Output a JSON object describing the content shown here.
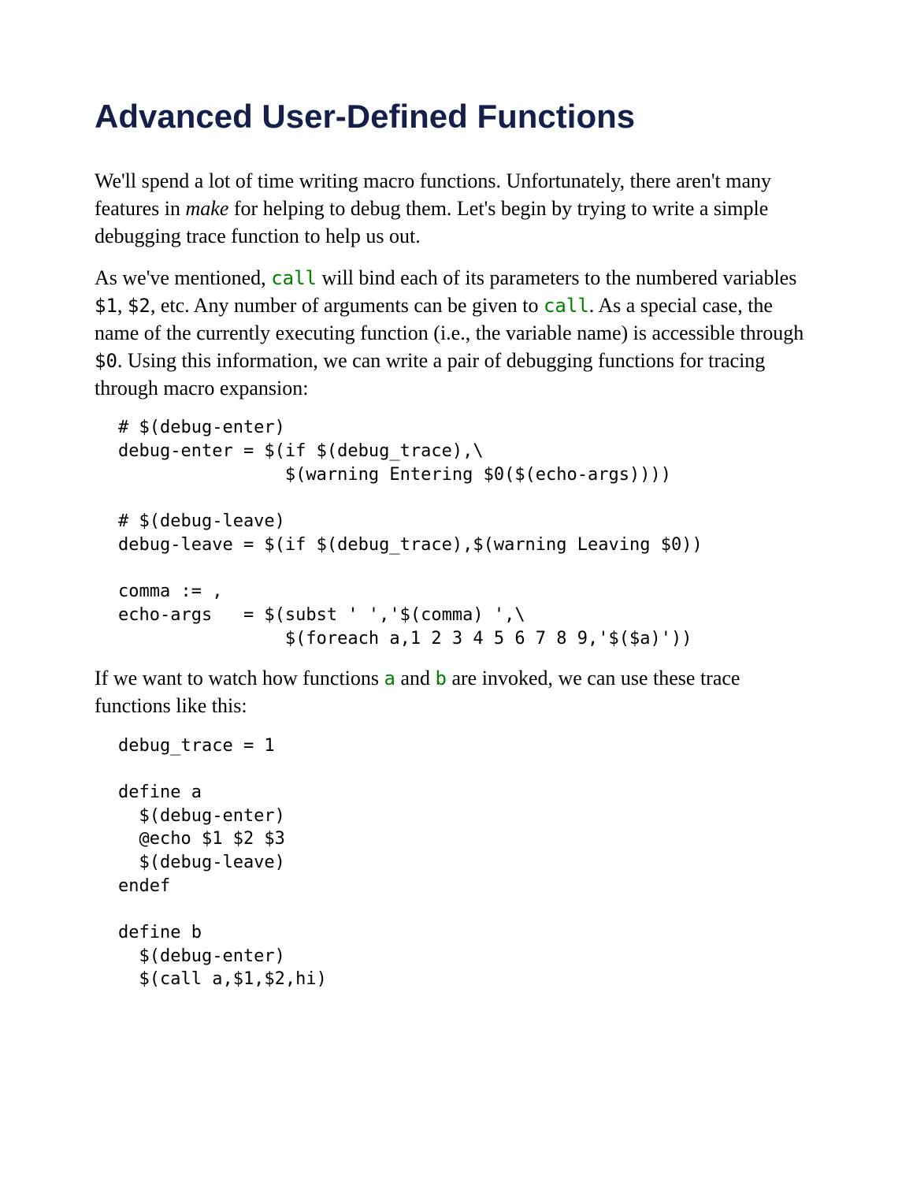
{
  "title": "Advanced User-Defined Functions",
  "para1_a": "We'll spend a lot of time writing macro functions. Unfortunately, there aren't many features in ",
  "para1_make": "make",
  "para1_b": " for helping to debug them. Let's begin by trying to write a simple debugging trace function to help us out.",
  "para2_a": "As we've mentioned, ",
  "para2_call1": "call",
  "para2_b": " will bind each of its parameters to the numbered variables ",
  "para2_v1": "$1",
  "para2_c": ", ",
  "para2_v2": "$2",
  "para2_d": ", etc. Any number of arguments can be given to ",
  "para2_call2": "call",
  "para2_e": ". As a special case, the name of the currently executing function (i.e., the variable name) is accessible through ",
  "para2_v0": "$0",
  "para2_f": ". Using this information, we can write a pair of debugging functions for tracing through macro expansion:",
  "code1": "# $(debug-enter)\ndebug-enter = $(if $(debug_trace),\\\n                $(warning Entering $0($(echo-args))))\n\n# $(debug-leave)\ndebug-leave = $(if $(debug_trace),$(warning Leaving $0))\n\ncomma := ,\necho-args   = $(subst ' ','$(comma) ',\\\n                $(foreach a,1 2 3 4 5 6 7 8 9,'$($a)'))",
  "para3_a": "If we want to watch how functions ",
  "para3_fn_a": "a",
  "para3_b": " and ",
  "para3_fn_b": "b",
  "para3_c": " are invoked, we can use these trace functions like this:",
  "code2": "debug_trace = 1\n\ndefine a\n  $(debug-enter)\n  @echo $1 $2 $3\n  $(debug-leave)\nendef\n\ndefine b\n  $(debug-enter)\n  $(call a,$1,$2,hi)"
}
